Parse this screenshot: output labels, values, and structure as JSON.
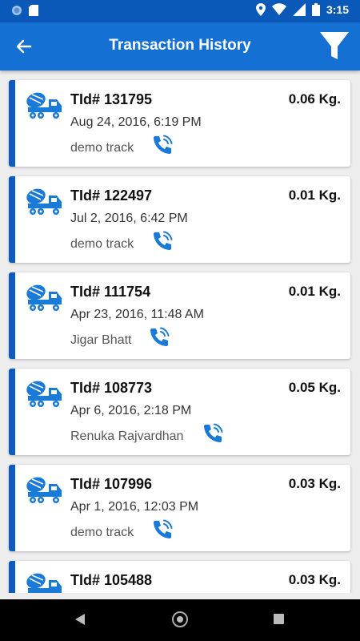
{
  "status_bar": {
    "time": "3:15"
  },
  "header": {
    "title": "Transaction History"
  },
  "colors": {
    "primary": "#1570d3",
    "status_bar": "#0a58b8",
    "accent": "#0d5bbf",
    "icon_blue": "#1a7ad8"
  },
  "transactions": [
    {
      "tid": "TId# 131795",
      "date": "Aug 24, 2016, 6:19 PM",
      "owner": "demo track",
      "weight": "0.06 Kg."
    },
    {
      "tid": "TId# 122497",
      "date": "Jul 2, 2016, 6:42 PM",
      "owner": "demo track",
      "weight": "0.01 Kg."
    },
    {
      "tid": "TId# 111754",
      "date": "Apr 23, 2016, 11:48 AM",
      "owner": "Jigar Bhatt",
      "weight": "0.01 Kg."
    },
    {
      "tid": "TId# 108773",
      "date": "Apr 6, 2016, 2:18 PM",
      "owner": "Renuka Rajvardhan",
      "weight": "0.05 Kg."
    },
    {
      "tid": "TId# 107996",
      "date": "Apr 1, 2016, 12:03 PM",
      "owner": "demo track",
      "weight": "0.03 Kg."
    },
    {
      "tid": "TId# 105488",
      "date": "",
      "owner": "",
      "weight": "0.03 Kg."
    }
  ],
  "icons": {
    "back": "arrow-left-icon",
    "filter": "funnel-icon",
    "truck": "concrete-mixer-truck-icon",
    "call": "phone-call-icon"
  }
}
